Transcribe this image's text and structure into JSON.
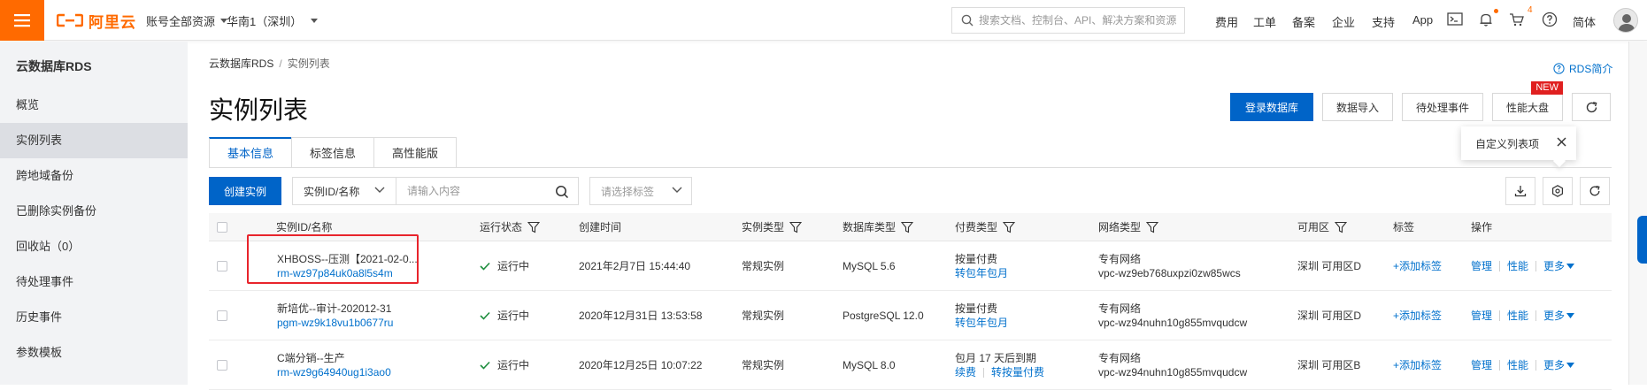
{
  "header": {
    "logo_text": "阿里云",
    "account_selector": "账号全部资源",
    "region_selector": "华南1（深圳）",
    "search_placeholder": "搜索文档、控制台、API、解决方案和资源",
    "links": [
      "费用",
      "工单",
      "备案",
      "企业",
      "支持",
      "App"
    ],
    "cart_count": "4",
    "language": "简体",
    "brand_color": "#ff6a00"
  },
  "sidebar": {
    "title": "云数据库RDS",
    "items": [
      {
        "label": "概览"
      },
      {
        "label": "实例列表"
      },
      {
        "label": "跨地域备份"
      },
      {
        "label": "已删除实例备份"
      },
      {
        "label": "回收站（0）"
      },
      {
        "label": "待处理事件"
      },
      {
        "label": "历史事件"
      },
      {
        "label": "参数模板"
      }
    ]
  },
  "breadcrumb": {
    "root": "云数据库RDS",
    "separator": "/",
    "current": "实例列表"
  },
  "help_link": "RDS简介",
  "page_title": "实例列表",
  "actions": {
    "login_db": "登录数据库",
    "data_import": "数据导入",
    "pending_events": "待处理事件",
    "perf_dashboard": "性能大盘",
    "new_flag": "NEW"
  },
  "tooltip": {
    "text": "自定义列表项"
  },
  "tabs": [
    "基本信息",
    "标签信息",
    "高性能版"
  ],
  "toolbar": {
    "create_instance": "创建实例",
    "filter_field": "实例ID/名称",
    "search_placeholder": "请输入内容",
    "tag_placeholder": "请选择标签"
  },
  "table": {
    "headers": {
      "id_name": "实例ID/名称",
      "status": "运行状态",
      "created": "创建时间",
      "instance_type": "实例类型",
      "db_type": "数据库类型",
      "billing": "付费类型",
      "network": "网络类型",
      "zone": "可用区",
      "tags": "标签",
      "ops": "操作"
    },
    "rows": [
      {
        "name": "XHBOSS--压测【2021-02-0...",
        "id": "rm-wz97p84uk0a8l5s4m",
        "status": "运行中",
        "created": "2021年2月7日 15:44:40",
        "instance_type": "常规实例",
        "db_type": "MySQL 5.6",
        "billing": "按量付费",
        "billing_link1": "转包年包月",
        "billing_link2": "",
        "network": "专有网络",
        "vpc": "vpc-wz9eb768uxpzi0zw85wcs",
        "zone": "深圳 可用区D",
        "add_tag": "+添加标签",
        "op_manage": "管理",
        "op_perf": "性能",
        "op_more": "更多"
      },
      {
        "name": "新培优--审计-202012-31",
        "id": "pgm-wz9k18vu1b0677ru",
        "status": "运行中",
        "created": "2020年12月31日 13:53:58",
        "instance_type": "常规实例",
        "db_type": "PostgreSQL 12.0",
        "billing": "按量付费",
        "billing_link1": "转包年包月",
        "billing_link2": "",
        "network": "专有网络",
        "vpc": "vpc-wz94nuhn10g855mvqudcw",
        "zone": "深圳 可用区D",
        "add_tag": "+添加标签",
        "op_manage": "管理",
        "op_perf": "性能",
        "op_more": "更多"
      },
      {
        "name": "C端分销--生产",
        "id": "rm-wz9g64940ug1i3ao0",
        "status": "运行中",
        "created": "2020年12月25日 10:07:22",
        "instance_type": "常规实例",
        "db_type": "MySQL 8.0",
        "billing": "包月 17 天后到期",
        "billing_link1": "续费",
        "billing_link2": "转按量付费",
        "network": "专有网络",
        "vpc": "vpc-wz94nuhn10g855mvqudcw",
        "zone": "深圳 可用区B",
        "add_tag": "+添加标签",
        "op_manage": "管理",
        "op_perf": "性能",
        "op_more": "更多"
      }
    ]
  }
}
